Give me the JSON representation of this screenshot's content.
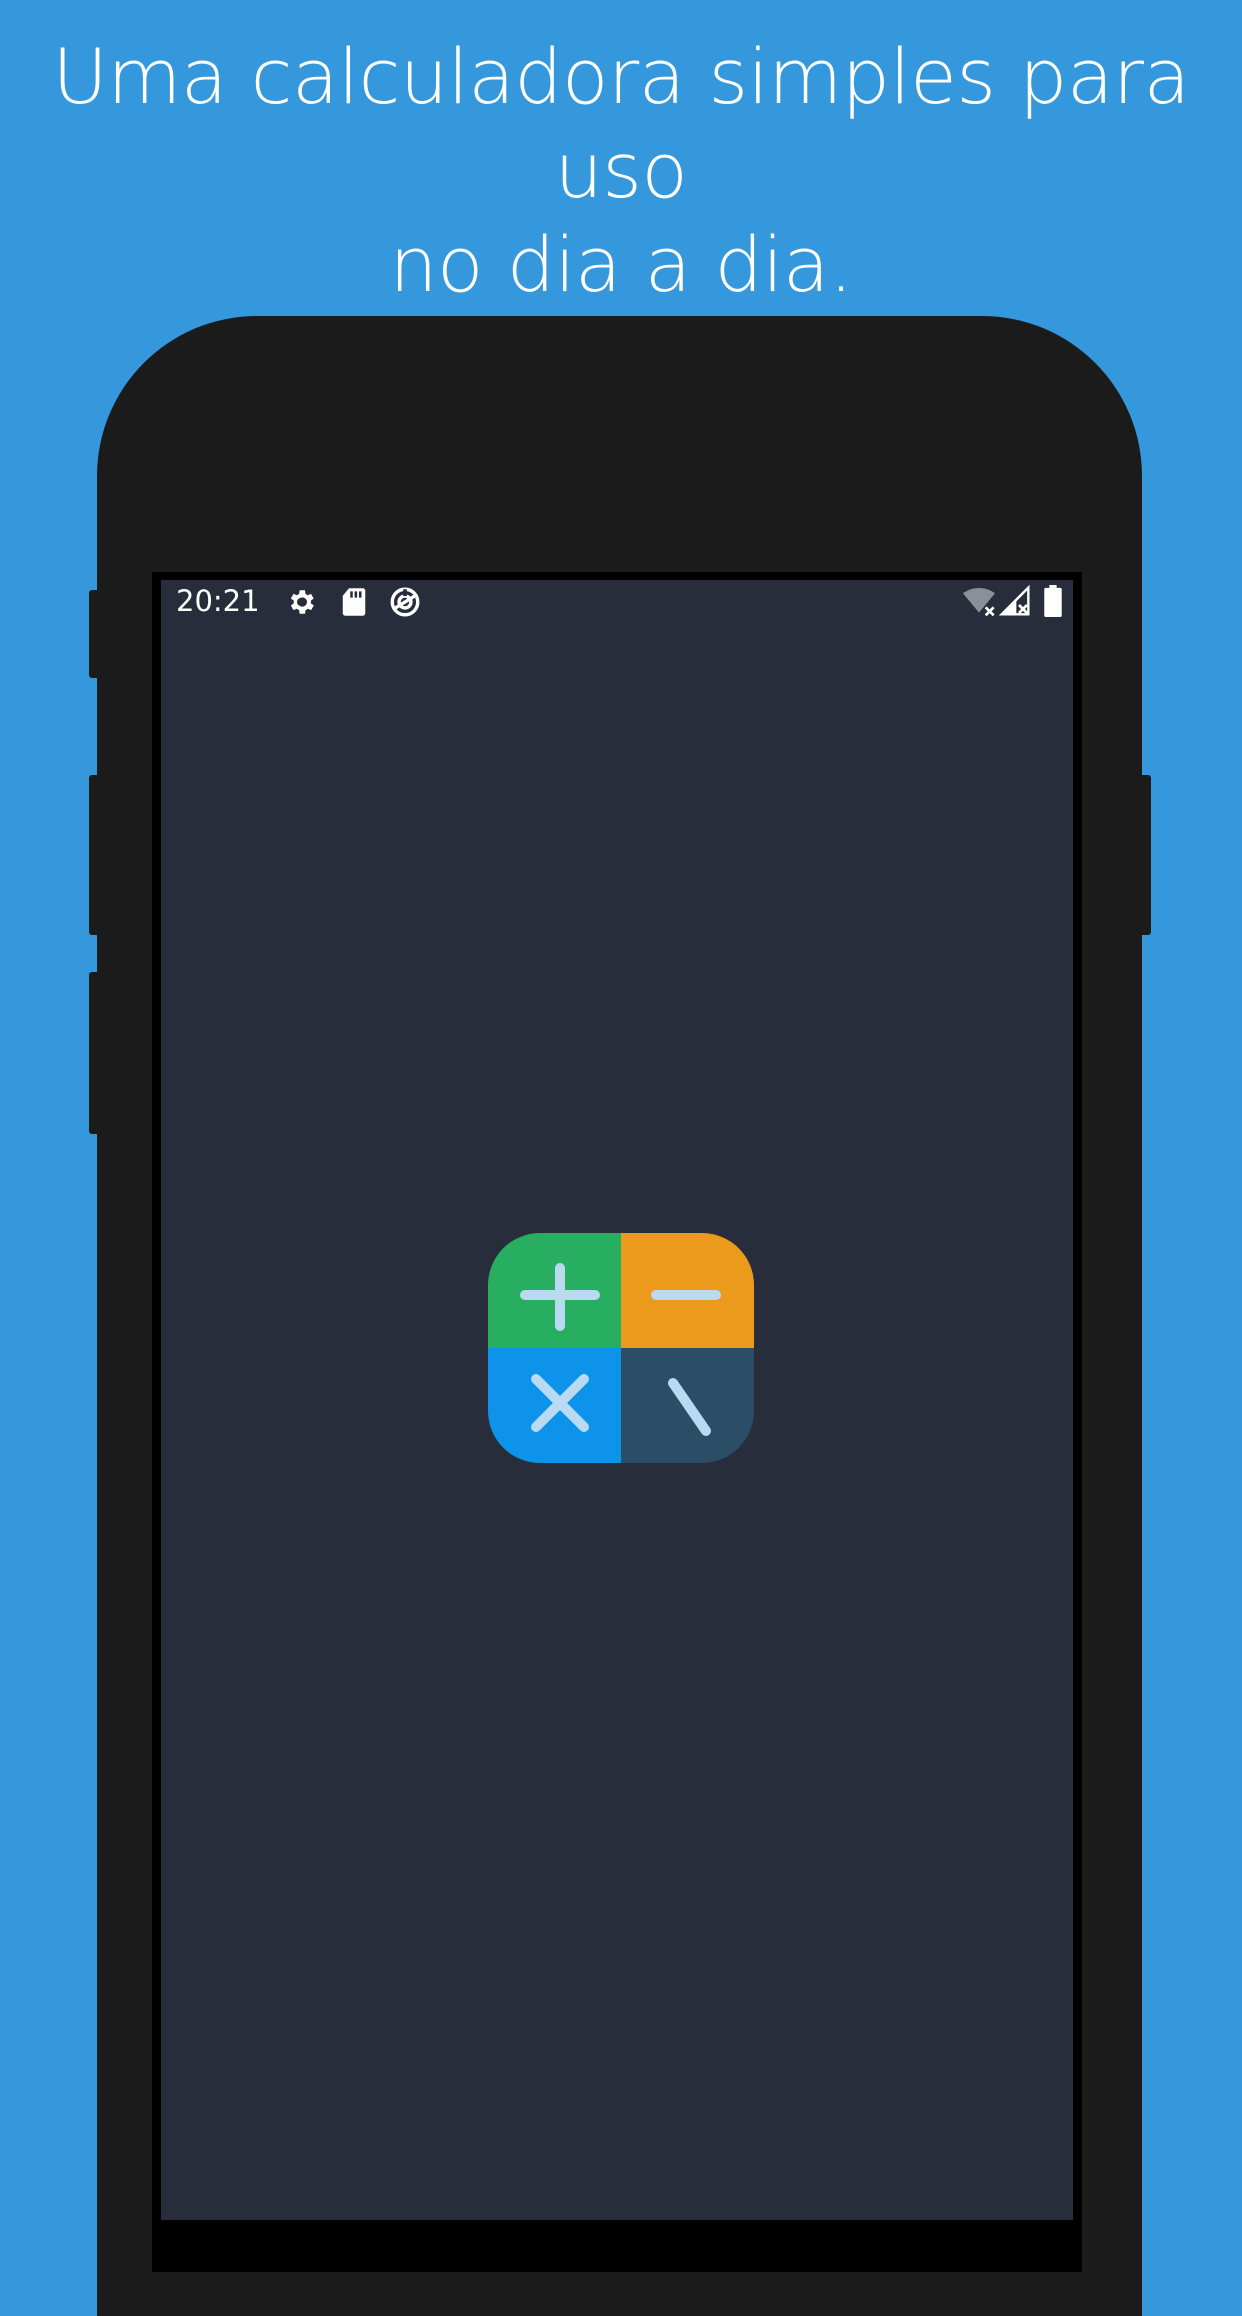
{
  "headline": {
    "line1": "Uma calculadora simples para uso",
    "line2": "no dia a dia."
  },
  "status_bar": {
    "time": "20:21",
    "left_icons": [
      "gear-icon",
      "sd-card-icon",
      "data-saver-icon"
    ],
    "right_icons": [
      "wifi-off-icon",
      "signal-off-icon",
      "battery-icon"
    ]
  },
  "app_icon": {
    "name": "calculator-app-icon",
    "tiles": [
      {
        "symbol": "plus",
        "color": "#27ae60"
      },
      {
        "symbol": "minus",
        "color": "#ec9a1c"
      },
      {
        "symbol": "multiply",
        "color": "#0d93ea"
      },
      {
        "symbol": "divide",
        "color": "#2b4e66"
      }
    ],
    "symbol_color": "#b9daf1"
  },
  "colors": {
    "page_background": "#3698dc",
    "phone_body": "#1b1b1b",
    "screen_background": "#272d3a",
    "headline_text": "#ffffff"
  }
}
